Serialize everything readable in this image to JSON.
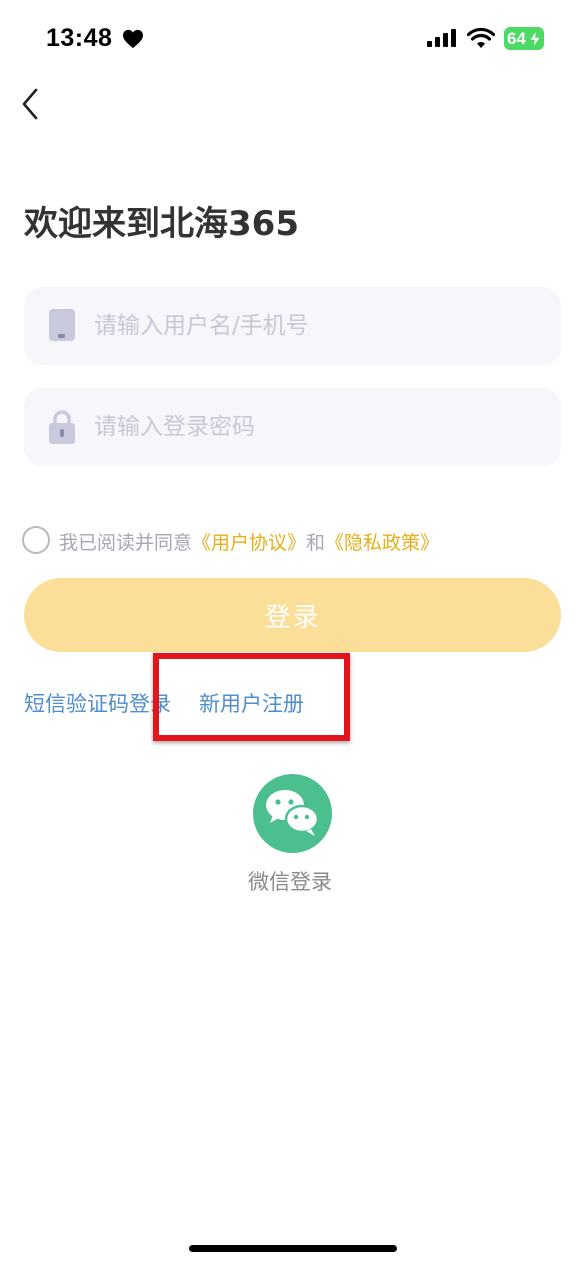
{
  "status_bar": {
    "time": "13:48",
    "battery": "64",
    "icons": [
      "heart-icon",
      "signal-icon",
      "wifi-icon",
      "battery-icon"
    ]
  },
  "nav": {
    "back_icon": "chevron-left-icon"
  },
  "welcome_title": "欢迎来到北海365",
  "form": {
    "username_placeholder": "请输入用户名/手机号",
    "password_placeholder": "请输入登录密码",
    "agree_prefix": "我已阅读并同意",
    "agree_user_agreement": "《用户协议》",
    "agree_and": "和",
    "agree_privacy_policy": "《隐私政策》",
    "login_label": "登录"
  },
  "links": {
    "sms_login": "短信验证码登录",
    "register": "新用户注册"
  },
  "wechat": {
    "label": "微信登录"
  },
  "colors": {
    "login_button": "#fbde98",
    "link": "#4e8ecb",
    "agreement_link": "#e8ae1c",
    "wechat": "#4bc08e",
    "highlight": "#e2141c"
  }
}
